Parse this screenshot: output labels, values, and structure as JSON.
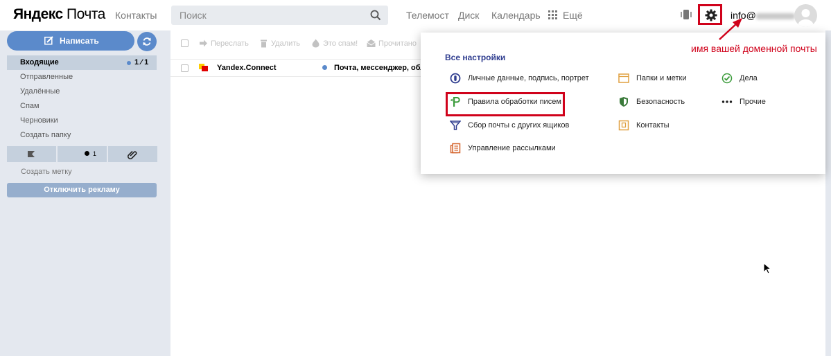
{
  "header": {
    "logo_bold": "Яндекс",
    "logo_rest": "Почта",
    "contacts": "Контакты",
    "search_placeholder": "Поиск",
    "links": [
      "Телемост",
      "Диск",
      "Календарь"
    ],
    "more": "Ещё",
    "email_prefix": "info@"
  },
  "sidebar": {
    "compose": "Написать",
    "folders": [
      {
        "label": "Входящие",
        "active": true,
        "count": "1 ⁄ 1"
      },
      {
        "label": "Отправленные"
      },
      {
        "label": "Удалённые"
      },
      {
        "label": "Спам"
      },
      {
        "label": "Черновики"
      },
      {
        "label": "Создать папку"
      }
    ],
    "unread_filter_count": "1",
    "create_tag": "Создать метку",
    "disable_ads": "Отключить рекламу"
  },
  "toolbar": {
    "forward": "Переслать",
    "delete": "Удалить",
    "spam": "Это спам!",
    "read": "Прочитано"
  },
  "messages": [
    {
      "sender": "Yandex.Connect",
      "subject": "Почта, мессенджер, обла"
    }
  ],
  "settings_menu": {
    "title": "Все настройки",
    "col1": [
      "Личные данные, подпись, портрет",
      "Правила обработки писем",
      "Сбор почты с других ящиков",
      "Управление рассылками"
    ],
    "col2": [
      "Папки и метки",
      "Безопасность",
      "Контакты"
    ],
    "col3": [
      "Дела",
      "Прочие"
    ]
  },
  "annotation": "имя вашей доменной почты",
  "colors": {
    "accent": "#5b8acb",
    "highlight": "#d0021b",
    "sidebar_bg": "#e4e8ef"
  }
}
